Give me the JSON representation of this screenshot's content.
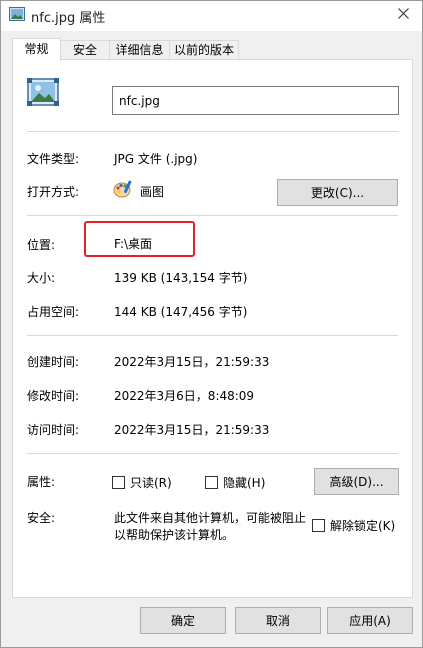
{
  "window": {
    "title": "nfc.jpg 属性"
  },
  "tabs": [
    {
      "label": "常规"
    },
    {
      "label": "安全"
    },
    {
      "label": "详细信息"
    },
    {
      "label": "以前的版本"
    }
  ],
  "general": {
    "file_name": "nfc.jpg",
    "file_type_label": "文件类型:",
    "file_type_value": "JPG 文件 (.jpg)",
    "open_with_label": "打开方式:",
    "open_with_app": "画图",
    "change_button": "更改(C)...",
    "location_label": "位置:",
    "location_value": "F:\\桌面",
    "size_label": "大小:",
    "size_value": "139 KB (143,154 字节)",
    "size_on_disk_label": "占用空间:",
    "size_on_disk_value": "144 KB (147,456 字节)",
    "created_label": "创建时间:",
    "created_value": "2022年3月15日，21:59:33",
    "modified_label": "修改时间:",
    "modified_value": "2022年3月6日，8:48:09",
    "accessed_label": "访问时间:",
    "accessed_value": "2022年3月15日，21:59:33",
    "attributes_label": "属性:",
    "readonly_label": "只读(R)",
    "hidden_label": "隐藏(H)",
    "advanced_button": "高级(D)...",
    "security_label": "安全:",
    "security_text_1": "此文件来自其他计算机，可能被阻止",
    "security_text_2": "以帮助保护该计算机。",
    "unblock_label": "解除锁定(K)"
  },
  "footer": {
    "ok_button": "确定",
    "cancel_button": "取消",
    "apply_button": "应用(A)"
  },
  "colors": {
    "highlight_border": "#e0232b",
    "panel_bg": "#ffffff",
    "window_bg": "#f0f0f0"
  }
}
